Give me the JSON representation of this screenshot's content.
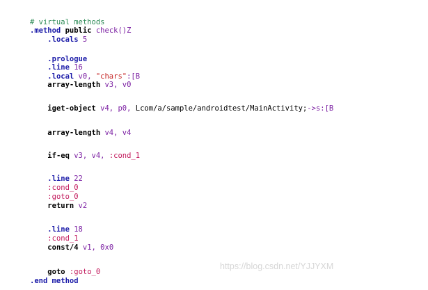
{
  "code": {
    "lines": [
      [
        {
          "t": "# virtual methods",
          "c": "comment"
        }
      ],
      [
        {
          "t": ".method",
          "c": "directive"
        },
        {
          "t": " ",
          "c": "plain"
        },
        {
          "t": "public",
          "c": "keyword"
        },
        {
          "t": " ",
          "c": "plain"
        },
        {
          "t": "check()Z",
          "c": "ident"
        }
      ],
      [
        {
          "t": "    ",
          "c": "plain"
        },
        {
          "t": ".locals",
          "c": "directive"
        },
        {
          "t": " 5",
          "c": "num"
        }
      ],
      [],
      [
        {
          "t": "    ",
          "c": "plain"
        },
        {
          "t": ".prologue",
          "c": "directive"
        }
      ],
      [
        {
          "t": "    ",
          "c": "plain"
        },
        {
          "t": ".line",
          "c": "directive"
        },
        {
          "t": " 16",
          "c": "num"
        }
      ],
      [
        {
          "t": "    ",
          "c": "plain"
        },
        {
          "t": ".local",
          "c": "directive"
        },
        {
          "t": " v0, ",
          "c": "ident"
        },
        {
          "t": "\"chars\"",
          "c": "string"
        },
        {
          "t": ":[B",
          "c": "ident"
        }
      ],
      [
        {
          "t": "    ",
          "c": "plain"
        },
        {
          "t": "array-length",
          "c": "keyword"
        },
        {
          "t": " v3, v0",
          "c": "ident"
        }
      ],
      [],
      [
        {
          "t": "    ",
          "c": "plain"
        },
        {
          "t": "iget-object",
          "c": "keyword"
        },
        {
          "t": " v4, p0, ",
          "c": "ident"
        },
        {
          "t": "Lcom/a/sample/androidtest/MainActivity;",
          "c": "plain"
        },
        {
          "t": "->s:[B",
          "c": "ident"
        }
      ],
      [],
      [
        {
          "t": "    ",
          "c": "plain"
        },
        {
          "t": "array-length",
          "c": "keyword"
        },
        {
          "t": " v4, v4",
          "c": "ident"
        }
      ],
      [],
      [
        {
          "t": "    ",
          "c": "plain"
        },
        {
          "t": "if-eq",
          "c": "keyword"
        },
        {
          "t": " v3, v4, ",
          "c": "ident"
        },
        {
          "t": ":cond_1",
          "c": "label"
        }
      ],
      [],
      [
        {
          "t": "    ",
          "c": "plain"
        },
        {
          "t": ".line",
          "c": "directive"
        },
        {
          "t": " 22",
          "c": "num"
        }
      ],
      [
        {
          "t": "    ",
          "c": "plain"
        },
        {
          "t": ":cond_0",
          "c": "label"
        }
      ],
      [
        {
          "t": "    ",
          "c": "plain"
        },
        {
          "t": ":goto_0",
          "c": "label"
        }
      ],
      [
        {
          "t": "    ",
          "c": "plain"
        },
        {
          "t": "return",
          "c": "keyword"
        },
        {
          "t": " v2",
          "c": "ident"
        }
      ],
      [],
      [
        {
          "t": "    ",
          "c": "plain"
        },
        {
          "t": ".line",
          "c": "directive"
        },
        {
          "t": " 18",
          "c": "num"
        }
      ],
      [
        {
          "t": "    ",
          "c": "plain"
        },
        {
          "t": ":cond_1",
          "c": "label"
        }
      ],
      [
        {
          "t": "    ",
          "c": "plain"
        },
        {
          "t": "const/4",
          "c": "keyword"
        },
        {
          "t": " v1, 0x0",
          "c": "ident"
        }
      ],
      [],
      [
        {
          "t": "    ",
          "c": "plain"
        },
        {
          "t": "goto",
          "c": "keyword"
        },
        {
          "t": " ",
          "c": "plain"
        },
        {
          "t": ":goto_0",
          "c": "label"
        }
      ],
      [
        {
          "t": ".end method",
          "c": "directive"
        }
      ]
    ]
  },
  "watermark": "https://blog.csdn.net/YJJYXM",
  "colors": {
    "comment": "#2e8b57",
    "directive": "#1a1aa8",
    "keyword": "#000000",
    "ident": "#7b1fa2",
    "string": "#c62828",
    "label": "#c2185b"
  }
}
